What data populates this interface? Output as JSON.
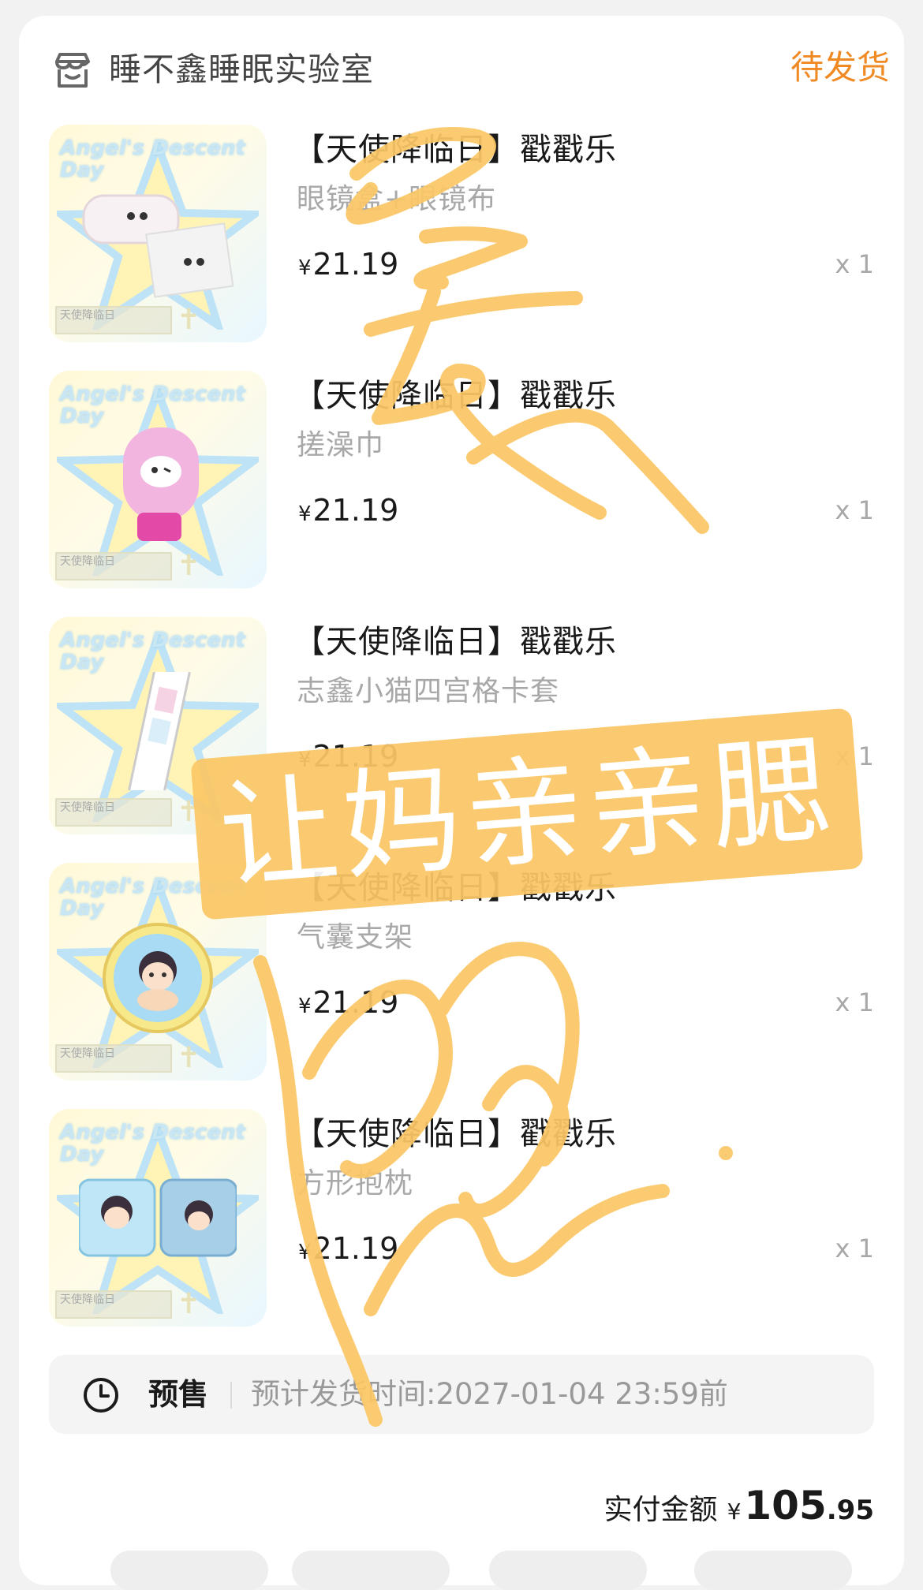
{
  "shop": {
    "name": "睡不鑫睡眠实验室",
    "status": "待发货"
  },
  "items": [
    {
      "title": "【天使降临日】戳戳乐",
      "subtitle": "眼镜盒+眼镜布",
      "price": "21.19",
      "currency": "¥",
      "qty": "x 1",
      "thumb_brand": "Angel's Descent Day",
      "thumb_tag": "天使降临日",
      "thumb_icon": "glasses-case-icon"
    },
    {
      "title": "【天使降临日】戳戳乐",
      "subtitle": "搓澡巾",
      "price": "21.19",
      "currency": "¥",
      "qty": "x 1",
      "thumb_brand": "Angel's Descent Day",
      "thumb_tag": "天使降临日",
      "thumb_icon": "bath-mitt-icon"
    },
    {
      "title": "【天使降临日】戳戳乐",
      "subtitle": "志鑫小猫四宫格卡套",
      "price": "21.19",
      "currency": "¥",
      "qty": "x 1",
      "thumb_brand": "Angel's Descent Day",
      "thumb_tag": "天使降临日",
      "thumb_icon": "card-sleeve-icon"
    },
    {
      "title": "【天使降临日】戳戳乐",
      "subtitle": "气囊支架",
      "price": "21.19",
      "currency": "¥",
      "qty": "x 1",
      "thumb_brand": "Angel's Descent Day",
      "thumb_tag": "天使降临日",
      "thumb_icon": "phone-grip-icon"
    },
    {
      "title": "【天使降临日】戳戳乐",
      "subtitle": "方形抱枕",
      "price": "21.19",
      "currency": "¥",
      "qty": "x 1",
      "thumb_brand": "Angel's Descent Day",
      "thumb_tag": "天使降临日",
      "thumb_icon": "pillow-icon"
    }
  ],
  "presale": {
    "label": "预售",
    "text": "预计发货时间:2027-01-04 23:59前",
    "icon": "clock-icon"
  },
  "total": {
    "label": "实付金额",
    "currency": "¥",
    "integer": "105",
    "decimal": ".95"
  },
  "overlay": {
    "stamp_text": "让妈亲亲腮",
    "stamp_color": "#fbc766",
    "scribble_color": "#fbc766"
  }
}
